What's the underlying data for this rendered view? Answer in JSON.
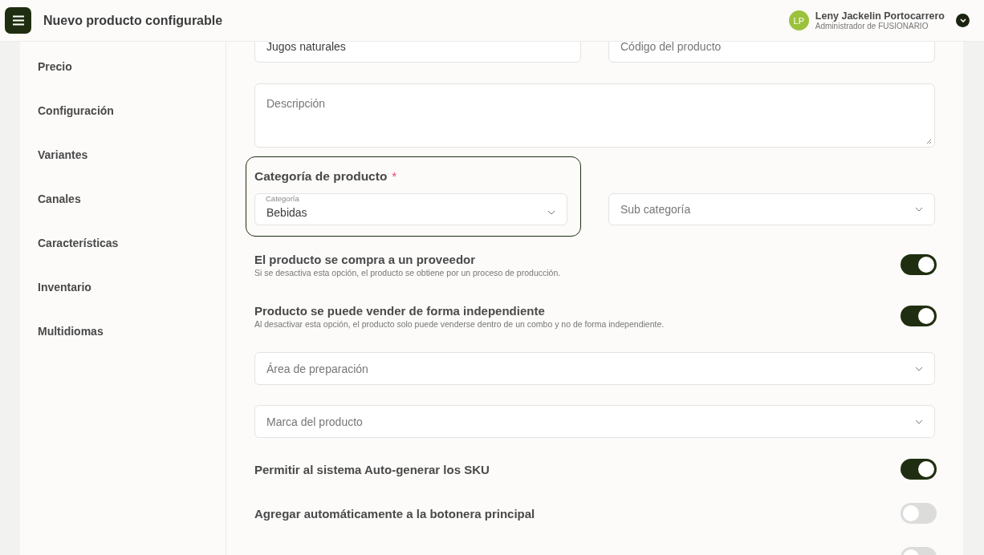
{
  "header": {
    "title": "Nuevo producto configurable",
    "user": {
      "initials": "LP",
      "name": "Leny Jackelin Portocarrero",
      "role": "Administrador de FUSIONARIO"
    }
  },
  "sidebar": {
    "items": [
      {
        "label": "Precio"
      },
      {
        "label": "Configuración"
      },
      {
        "label": "Variantes"
      },
      {
        "label": "Canales"
      },
      {
        "label": "Características"
      },
      {
        "label": "Inventario"
      },
      {
        "label": "Multidiomas"
      }
    ]
  },
  "form": {
    "name_field": {
      "value": "Jugos naturales"
    },
    "code_field": {
      "placeholder": "Código del producto"
    },
    "description_field": {
      "placeholder": "Descripción"
    },
    "category_section": {
      "title": "Categoría de producto",
      "required_mark": "*",
      "category": {
        "label": "Categoría",
        "value": "Bebidas"
      },
      "subcategory": {
        "placeholder": "Sub categoría"
      }
    },
    "toggles_top": [
      {
        "title": "El producto se compra a un proveedor",
        "description": "Si se desactiva esta opción, el producto se obtiene por un proceso de producción.",
        "on": true
      },
      {
        "title": "Producto se puede vender de forma independiente",
        "description": "Al desactivar esta opción, el producto solo puede venderse dentro de un combo y no de forma independiente.",
        "on": true
      }
    ],
    "selects": [
      {
        "placeholder": "Área de preparación"
      },
      {
        "placeholder": "Marca del producto"
      }
    ],
    "toggles_bottom": [
      {
        "title": "Permitir al sistema Auto-generar los SKU",
        "on": true
      },
      {
        "title": "Agregar automáticamente a la botonera principal",
        "on": false
      },
      {
        "on": false
      }
    ]
  }
}
